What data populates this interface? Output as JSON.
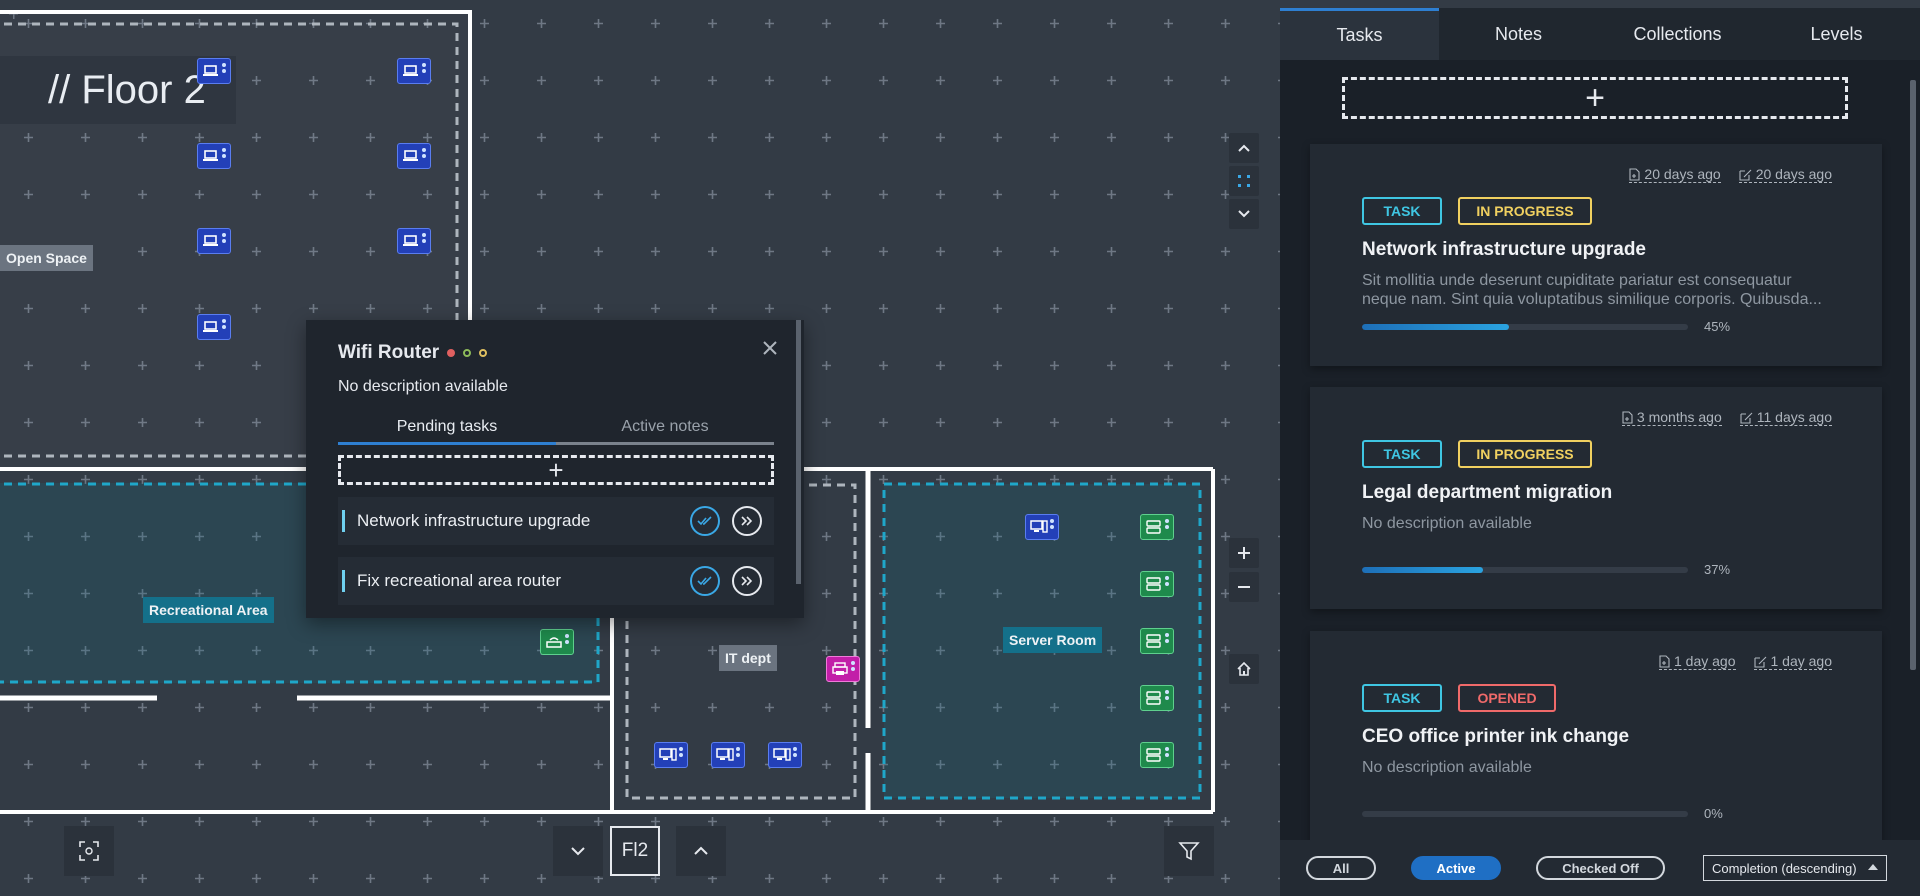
{
  "floor": {
    "title": "// Floor 2",
    "selector_label": "Fl2"
  },
  "areas": {
    "open_space": "Open Space",
    "recreational": "Recreational Area",
    "it_dept": "IT dept",
    "server_room": "Server Room"
  },
  "popup": {
    "title": "Wifi Router",
    "description": "No description available",
    "tabs": [
      "Pending tasks",
      "Active notes"
    ],
    "add_symbol": "+",
    "items": [
      {
        "label": "Network infrastructure upgrade"
      },
      {
        "label": "Fix recreational area router"
      }
    ]
  },
  "panel": {
    "tabs": [
      "Tasks",
      "Notes",
      "Collections",
      "Levels"
    ],
    "add_symbol": "+",
    "cards": [
      {
        "created": "20 days ago",
        "edited": "20 days ago",
        "type": "TASK",
        "status": "IN PROGRESS",
        "title": "Network infrastructure upgrade",
        "description": "Sit mollitia unde deserunt cupiditate pariatur est consequatur neque nam. Sint quia voluptatibus similique corporis. Quibusda...",
        "progress": 45,
        "progress_label": "45%"
      },
      {
        "created": "3 months ago",
        "edited": "11 days ago",
        "type": "TASK",
        "status": "IN PROGRESS",
        "title": "Legal department migration",
        "description": "No description available",
        "progress": 37,
        "progress_label": "37%"
      },
      {
        "created": "1 day ago",
        "edited": "1 day ago",
        "type": "TASK",
        "status": "OPENED",
        "title": "CEO office printer ink change",
        "description": "No description available",
        "progress": 0,
        "progress_label": "0%"
      }
    ],
    "filters": {
      "all": "All",
      "active": "Active",
      "checked_off": "Checked Off"
    },
    "sort": "Completion (descending)"
  },
  "colors": {
    "accent": "#2e7fd1",
    "task": "#3fc6e3",
    "in_progress": "#f0d060",
    "opened": "#f06a6a"
  }
}
